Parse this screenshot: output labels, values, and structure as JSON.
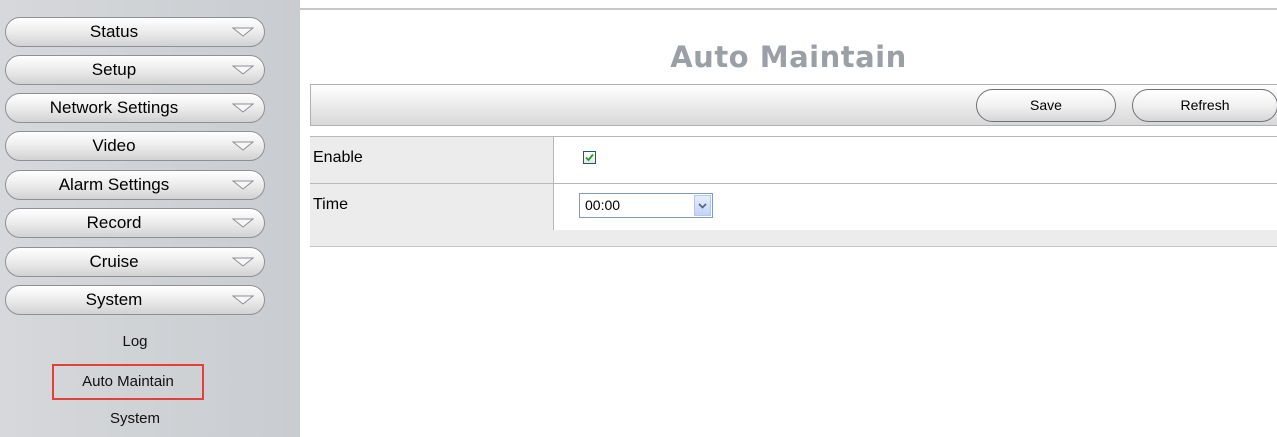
{
  "sidebar": {
    "menu": [
      {
        "label": "Status"
      },
      {
        "label": "Setup"
      },
      {
        "label": "Network Settings"
      },
      {
        "label": "Video"
      },
      {
        "label": "Alarm Settings"
      },
      {
        "label": "Record"
      },
      {
        "label": "Cruise"
      },
      {
        "label": "System"
      }
    ],
    "submenu": [
      {
        "label": "Log"
      },
      {
        "label": "Auto Maintain",
        "active": true
      },
      {
        "label": "System"
      }
    ]
  },
  "page": {
    "title": "Auto Maintain"
  },
  "toolbar": {
    "save_label": "Save",
    "refresh_label": "Refresh"
  },
  "form": {
    "enable_label": "Enable",
    "enable_checked": true,
    "time_label": "Time",
    "time_value": "00:00"
  },
  "colors": {
    "highlight_border": "#e4403a",
    "title": "#9aa0a6"
  }
}
